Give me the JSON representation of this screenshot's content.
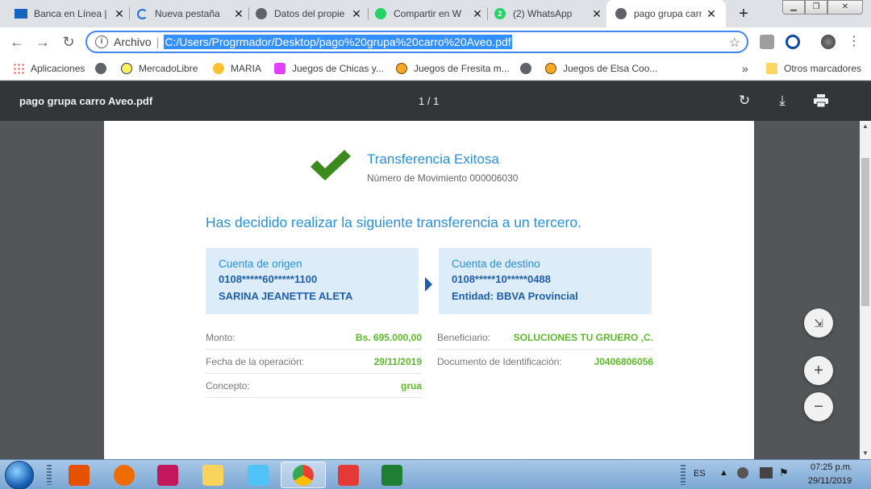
{
  "tabs": [
    {
      "label": "Banca en Línea |",
      "icon": "banco-icon",
      "active": false
    },
    {
      "label": "Nueva pestaña",
      "icon": "loading-icon",
      "active": false
    },
    {
      "label": "Datos del propie",
      "icon": "globe-icon",
      "active": false
    },
    {
      "label": "Compartir en W",
      "icon": "whatsapp-icon",
      "active": false
    },
    {
      "label": "(2) WhatsApp",
      "icon": "whatsapp-badge-icon",
      "active": false
    },
    {
      "label": "pago grupa carr",
      "icon": "globe-icon",
      "active": true
    }
  ],
  "toolbar": {
    "scheme": "Archivo",
    "url": "C:/Users/Progrmador/Desktop/pago%20grupa%20carro%20Aveo.pdf"
  },
  "bookmarks": [
    {
      "label": "Aplicaciones"
    },
    {
      "label": ""
    },
    {
      "label": "MercadoLibre"
    },
    {
      "label": "MARIA"
    },
    {
      "label": "Juegos de Chicas y..."
    },
    {
      "label": "Juegos de Fresita m..."
    },
    {
      "label": ""
    },
    {
      "label": "Juegos de Elsa Coo..."
    }
  ],
  "bookmarks_overflow": "»",
  "other_bookmarks": "Otros marcadores",
  "pdf": {
    "title": "pago grupa carro Aveo.pdf",
    "pages": "1 / 1"
  },
  "receipt": {
    "status_title": "Transferencia Exitosa",
    "movement": "Número de Movimiento 000006030",
    "heading": "Has decidido realizar la siguiente transferencia a un tercero.",
    "origin": {
      "label": "Cuenta de origen",
      "number": "0108*****60*****1100",
      "name": "SARINA JEANETTE ALETA"
    },
    "destination": {
      "label": "Cuenta de destino",
      "number": "0108*****10*****0488",
      "entity": "Entidad: BBVA Provincial"
    },
    "details_left": [
      {
        "key": "Monto:",
        "value": "Bs. 695.000,00"
      },
      {
        "key": "Fecha de la operación:",
        "value": "29/11/2019"
      },
      {
        "key": "Concepto:",
        "value": "grua"
      }
    ],
    "details_right": [
      {
        "key": "Beneficiario:",
        "value": "SOLUCIONES TU GRUERO ,C."
      },
      {
        "key": "Documento de Identificación:",
        "value": "J0406806056"
      }
    ]
  },
  "taskbar": {
    "language": "ES",
    "time": "07:25 p.m.",
    "date": "29/11/2019"
  },
  "colors": {
    "accent_blue": "#2a8fd6",
    "success_green": "#5cb82a",
    "pdf_toolbar": "#323639",
    "omnibox_highlight": "#3390ff"
  }
}
